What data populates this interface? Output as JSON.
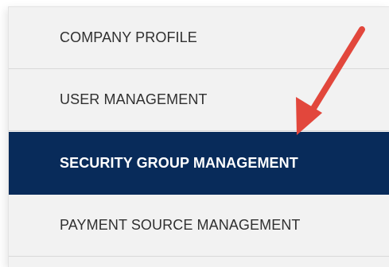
{
  "colors": {
    "active_bg": "#082b5a",
    "active_text": "#ffffff",
    "item_bg": "#f2f2f2",
    "item_text": "#303030",
    "arrow": "#e2473c"
  },
  "menu": {
    "items": [
      {
        "label": "COMPANY PROFILE",
        "active": false
      },
      {
        "label": "USER MANAGEMENT",
        "active": false
      },
      {
        "label": "SECURITY GROUP MANAGEMENT",
        "active": true
      },
      {
        "label": "PAYMENT SOURCE MANAGEMENT",
        "active": false
      },
      {
        "label": "",
        "active": false
      }
    ]
  },
  "annotation": {
    "icon": "red-arrow-icon"
  }
}
